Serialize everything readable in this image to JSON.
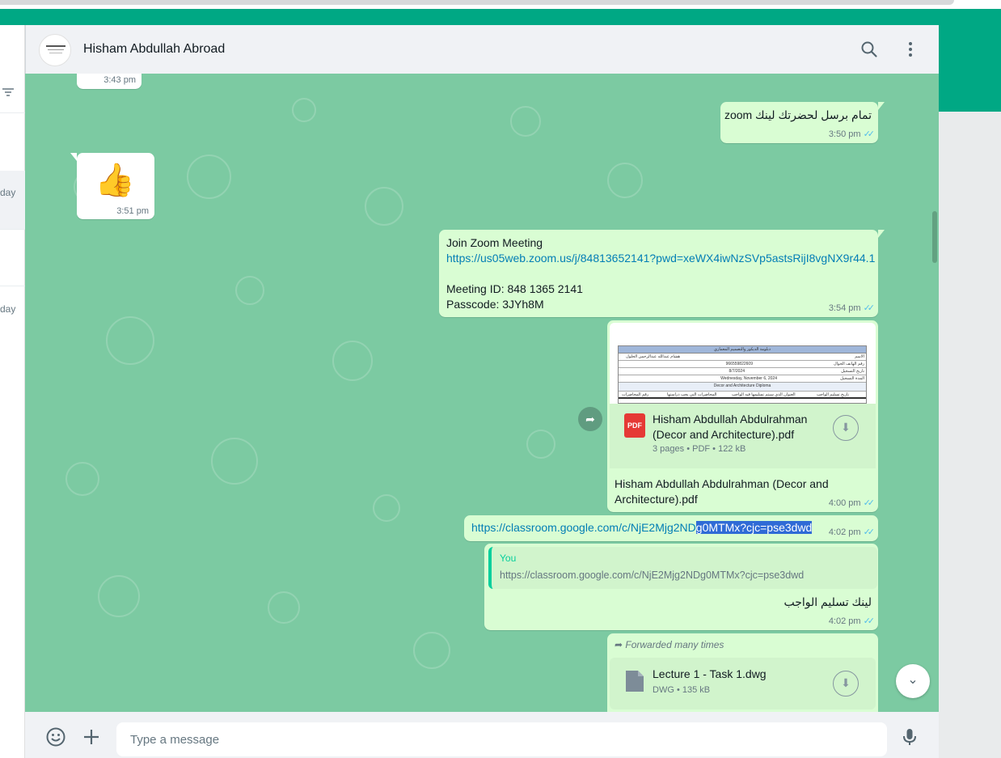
{
  "chat": {
    "contact_name": "Hisham Abdullah Abroad",
    "input_placeholder": "Type a message"
  },
  "sidebar": {
    "day_labels": [
      "day",
      "day"
    ]
  },
  "messages": {
    "m0_time": "3:43 pm",
    "m1_text": "تمام برسل لحضرتك لينك zoom",
    "m1_time": "3:50 pm",
    "m2_emoji": "👍",
    "m2_time": "3:51 pm",
    "m3_line1": "Join Zoom Meeting",
    "m3_link": "https://us05web.zoom.us/j/84813652141?pwd=xeWX4iwNzSVp5astsRijI8vgNX9r44.1",
    "m3_line3": "Meeting ID: 848 1365 2141",
    "m3_line4": "Passcode: 3JYh8M",
    "m3_time": "3:54 pm",
    "m4_file_name": "Hisham Abdullah Abdulrahman (Decor and Architecture).pdf",
    "m4_file_meta": "3 pages • PDF • 122 kB",
    "m4_file_type": "PDF",
    "m4_caption": "Hisham Abdullah Abdulrahman (Decor and Architecture).pdf",
    "m4_time": "4:00 pm",
    "m4_preview": {
      "header": "دبلومة الديكور والتصميم المعماري",
      "rows": [
        {
          "label": "الاسم",
          "value": "هشام عبدالله عبدالرحمن الحلول"
        },
        {
          "label": "رقم الهاتف الجوال",
          "value": "966559822609"
        },
        {
          "label": "تاريخ التسجيل",
          "value": "8/7/2024"
        },
        {
          "label": "المدة التسجيل",
          "value": "Wednesday, November 6, 2024"
        }
      ],
      "title": "Decor and Architecture Diploma",
      "cols": [
        "رقم المحاضرات",
        "المحاضرات التي يجب دراستها",
        "العنوان الذي سيتم تسليمها فيه الواجب",
        "تاريخ تسليم الواجب"
      ]
    },
    "m5_link_a": "https://classroom.google.com/c/NjE2Mjg2ND",
    "m5_link_b": "g0MTMx?cjc=pse3dwd",
    "m5_time": "4:02 pm",
    "m6_quote_author": "You",
    "m6_quote_text": "https://classroom.google.com/c/NjE2Mjg2NDg0MTMx?cjc=pse3dwd",
    "m6_text": "لينك تسليم الواجب",
    "m6_time": "4:02 pm",
    "m7_forwarded": "Forwarded many times",
    "m7_file_name": "Lecture 1 - Task 1.dwg",
    "m7_file_meta": "DWG • 135 kB"
  },
  "colors": {
    "accent": "#00a884",
    "chat_bg": "#7ccaa2",
    "outgoing": "#d9fdd3",
    "ticks": "#53bdeb"
  },
  "icons": [
    "search-icon",
    "menu-icon",
    "filter-icon",
    "emoji-icon",
    "plus-icon",
    "mic-icon",
    "download-icon",
    "forward-icon",
    "chevron-down-icon",
    "double-check-icon",
    "pdf-icon",
    "file-icon",
    "thumbs-up-emoji"
  ]
}
